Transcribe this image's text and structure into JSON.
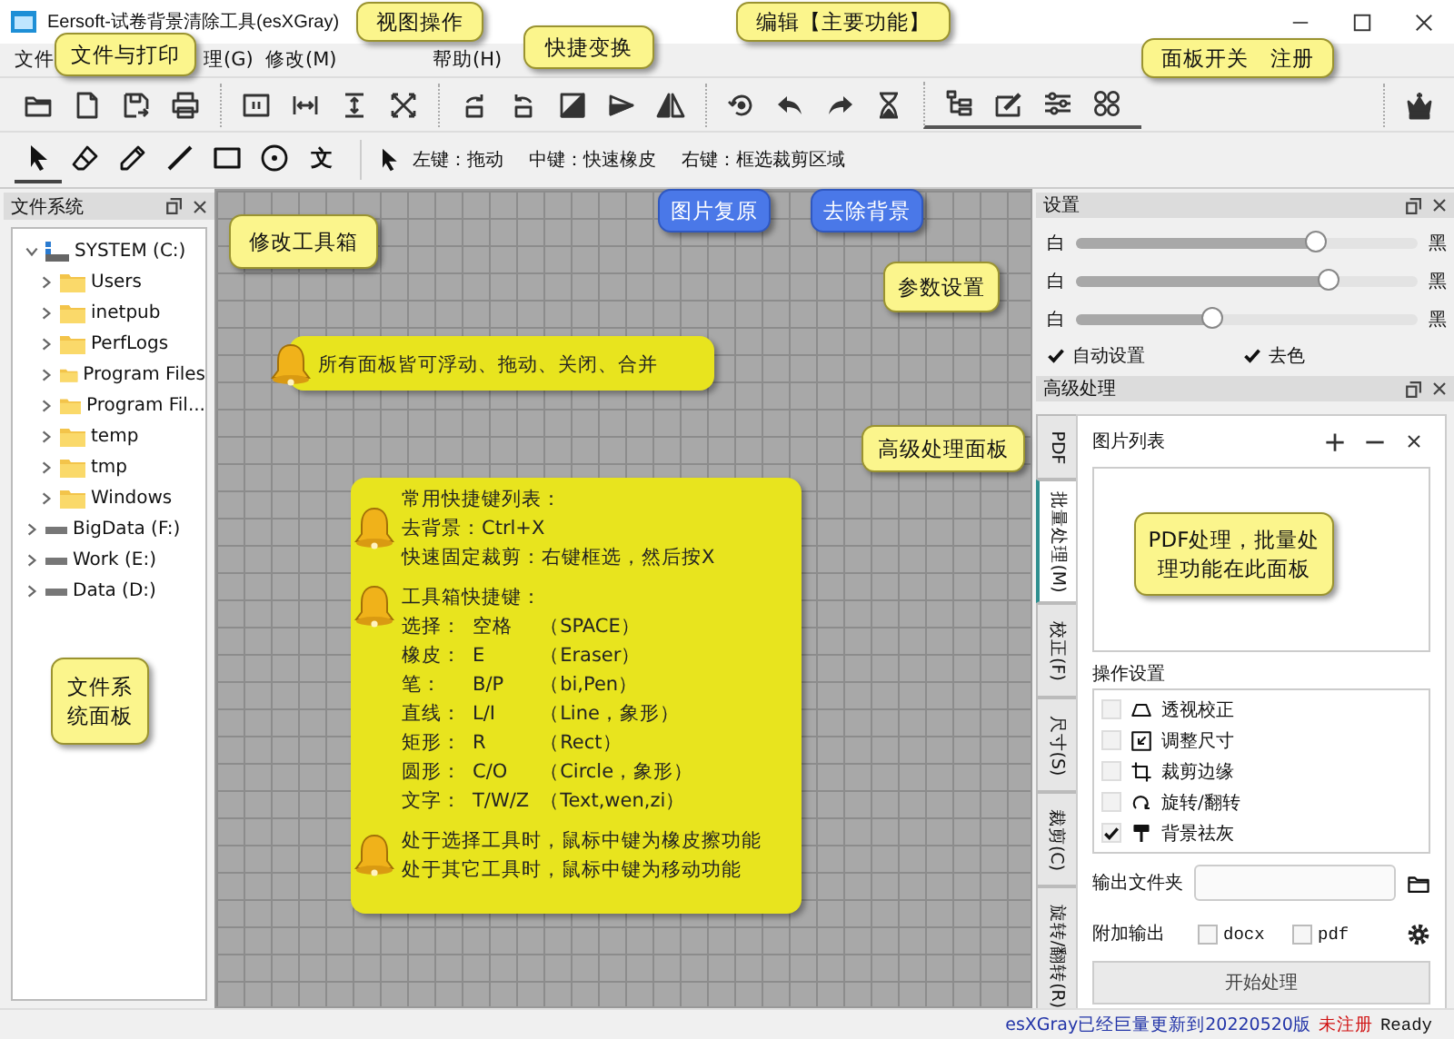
{
  "window": {
    "title": "Eersoft-试卷背景清除工具(esXGray)"
  },
  "menu": [
    "文件",
    "理(G)",
    "修改(M)",
    "帮助(H)"
  ],
  "tools": [
    {
      "kind": "select",
      "selected": true
    },
    {
      "kind": "eraser",
      "selected": false
    },
    {
      "kind": "pencil",
      "selected": false
    },
    {
      "kind": "line",
      "selected": false
    },
    {
      "kind": "rect",
      "selected": false
    },
    {
      "kind": "circle",
      "selected": false
    },
    {
      "kind": "text",
      "label": "文",
      "selected": false
    }
  ],
  "hints": [
    "左键：拖动",
    "中键：快速橡皮",
    "右键：框选裁剪区域"
  ],
  "file_panel": {
    "title": "文件系统"
  },
  "file_tree": [
    {
      "label": "SYSTEM (C:)",
      "kind": "system",
      "expanded": true,
      "children": [
        {
          "label": "Users",
          "kind": "folder",
          "expanded": false
        },
        {
          "label": "inetpub",
          "kind": "folder",
          "expanded": false
        },
        {
          "label": "PerfLogs",
          "kind": "folder",
          "expanded": false
        },
        {
          "label": "Program Files",
          "kind": "folder",
          "expanded": false
        },
        {
          "label": "Program Fil...",
          "kind": "folder",
          "expanded": false
        },
        {
          "label": "temp",
          "kind": "folder",
          "expanded": false
        },
        {
          "label": "tmp",
          "kind": "folder",
          "expanded": false
        },
        {
          "label": "Windows",
          "kind": "folder",
          "expanded": false
        }
      ]
    },
    {
      "label": "BigData (F:)",
      "kind": "drive",
      "expanded": false
    },
    {
      "label": "Work (E:)",
      "kind": "drive",
      "expanded": false
    },
    {
      "label": "Data (D:)",
      "kind": "drive",
      "expanded": false
    }
  ],
  "notes": [
    {
      "sections": [
        {
          "lines": [
            "所有面板皆可浮动、拖动、关闭、合并"
          ]
        }
      ]
    },
    {
      "sections": [
        {
          "lines": [
            "常用快捷键列表：",
            "去背景：Ctrl+X",
            "快速固定裁剪：右键框选，然后按X"
          ]
        },
        {
          "lines": [
            "工具箱快捷键："
          ],
          "rows": [
            [
              "选择：",
              "空格",
              "（SPACE）"
            ],
            [
              "橡皮：",
              "E",
              "（Eraser）"
            ],
            [
              "笔：",
              "B/P",
              "（bi,Pen）"
            ],
            [
              "直线：",
              "L/I",
              "（Line，象形）"
            ],
            [
              "矩形：",
              "R",
              "（Rect）"
            ],
            [
              "圆形：",
              "C/O",
              "（Circle，象形）"
            ],
            [
              "文字：",
              "T/W/Z",
              "（Text,wen,zi）"
            ]
          ]
        },
        {
          "lines": [
            "处于选择工具时，鼠标中键为橡皮擦功能",
            "处于其它工具时，鼠标中键为移动功能"
          ]
        }
      ]
    }
  ],
  "settings": {
    "title": "设置",
    "sliders": [
      {
        "left": "白",
        "right": "黑",
        "level": 0.7
      },
      {
        "left": "白",
        "right": "黑",
        "level": 0.74
      },
      {
        "left": "白",
        "right": "黑",
        "level": 0.4
      }
    ],
    "checkboxes": [
      {
        "label": "自动设置",
        "checked": true
      },
      {
        "label": "去色",
        "checked": true
      }
    ]
  },
  "advanced": {
    "title": "高级处理",
    "tabs": [
      {
        "label": "PDF",
        "selected": false
      },
      {
        "label": "批量处理(M)",
        "selected": true
      },
      {
        "label": "校正(F)",
        "selected": false
      },
      {
        "label": "尺寸(S)",
        "selected": false
      },
      {
        "label": "裁剪(C)",
        "selected": false
      },
      {
        "label": "旋转/翻转(R)",
        "selected": false
      }
    ],
    "image_list_title": "图片列表",
    "operations_title": "操作设置",
    "operations": [
      {
        "label": "透视校正",
        "kind": "perspective",
        "checked": false
      },
      {
        "label": "调整尺寸",
        "kind": "resize",
        "checked": false
      },
      {
        "label": "裁剪边缘",
        "kind": "crop",
        "checked": false
      },
      {
        "label": "旋转/翻转",
        "kind": "rotate",
        "checked": false
      },
      {
        "label": "背景祛灰",
        "kind": "brush",
        "checked": true
      }
    ],
    "output_folder_label": "输出文件夹",
    "extra_output_label": "附加输出",
    "extra_outputs": [
      {
        "label": "docx",
        "checked": false
      },
      {
        "label": "pdf",
        "checked": false
      }
    ],
    "start_button": "开始处理"
  },
  "status_bar": {
    "message": "esXGray已经巨量更新到20220520版",
    "registration": "未注册",
    "state": "Ready"
  },
  "callouts": [
    {
      "text": "文件与打印",
      "kind": "yellow"
    },
    {
      "text": "视图操作",
      "kind": "yellow"
    },
    {
      "text": "快捷变换",
      "kind": "yellow"
    },
    {
      "text": "编辑【主要功能】",
      "kind": "yellow"
    },
    {
      "text": "面板开关　注册",
      "kind": "yellow"
    },
    {
      "text": "修改工具箱",
      "kind": "yellow"
    },
    {
      "text": "参数设置",
      "kind": "yellow"
    },
    {
      "text": "高级处理面板",
      "kind": "yellow"
    },
    {
      "text": "文件系统面板",
      "kind": "yellow"
    },
    {
      "text": "PDF处理，批量处理功能在此面板",
      "kind": "yellow"
    },
    {
      "text": "图片复原",
      "kind": "blue"
    },
    {
      "text": "去除背景",
      "kind": "blue"
    }
  ]
}
